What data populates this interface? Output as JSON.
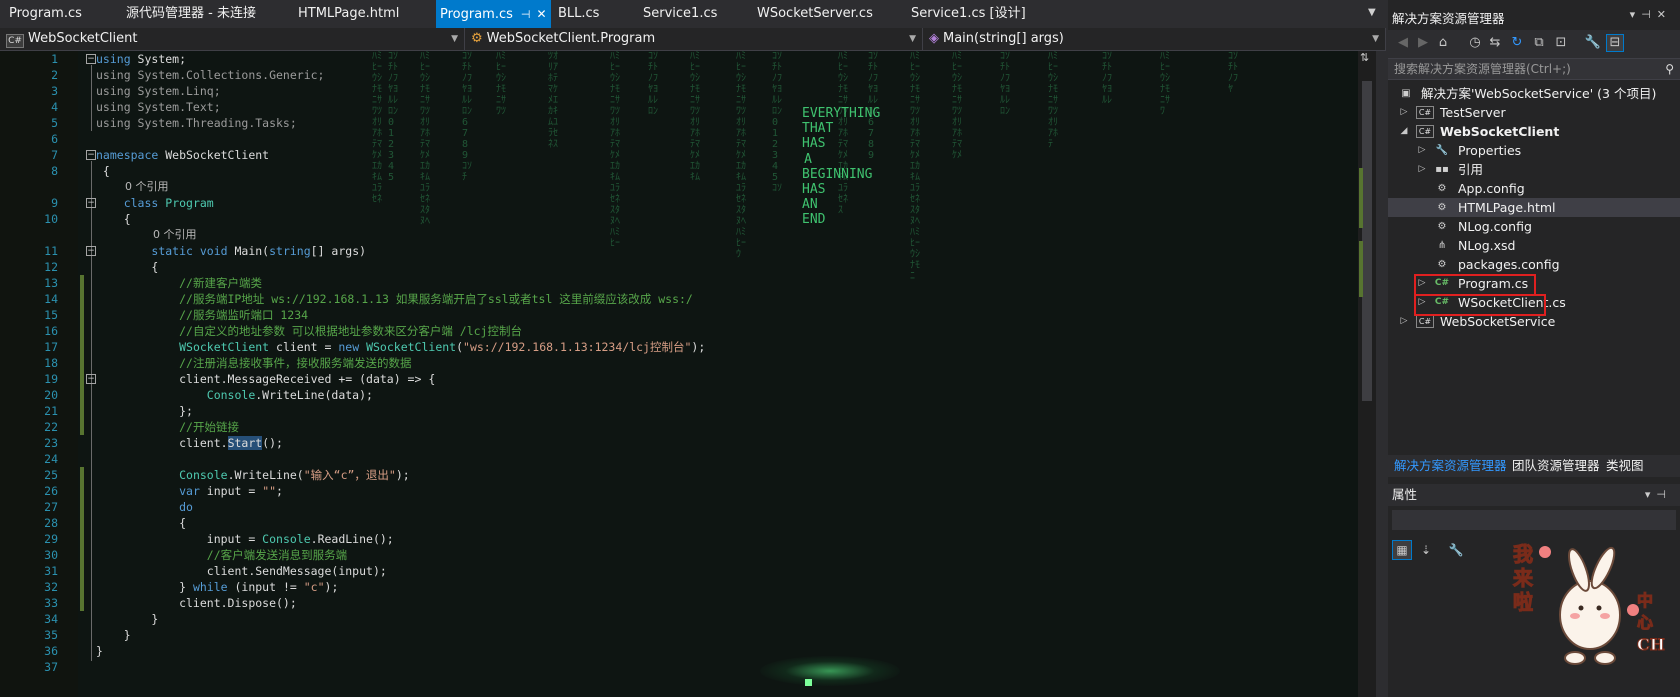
{
  "tabs": [
    {
      "label": "Program.cs"
    },
    {
      "label": "源代码管理器 - 未连接"
    },
    {
      "label": "HTMLPage.html"
    },
    {
      "label": "Program.cs",
      "active": true
    },
    {
      "label": "BLL.cs"
    },
    {
      "label": "Service1.cs"
    },
    {
      "label": "WSocketServer.cs"
    },
    {
      "label": "Service1.cs [设计]"
    }
  ],
  "nav": {
    "project": "WebSocketClient",
    "class": "WebSocketClient.Program",
    "member": "Main(string[] args)"
  },
  "code": {
    "line_numbers": [
      "1",
      "2",
      "3",
      "4",
      "5",
      "6",
      "7",
      "8",
      "9",
      "10",
      "11",
      "12",
      "13",
      "14",
      "15",
      "16",
      "17",
      "18",
      "19",
      "20",
      "21",
      "22",
      "23",
      "24",
      "25",
      "26",
      "27",
      "28",
      "29",
      "30",
      "31",
      "32",
      "33",
      "34",
      "35",
      "36",
      "37"
    ],
    "ref_class": "0 个引用",
    "ref_main": "0 个引用",
    "comments": {
      "new_client": "//新建客户端类",
      "server_ip": "//服务端IP地址 ws://192.168.1.13 如果服务端开启了ssl或者tsl 这里前缀应该改成 wss:/",
      "server_port": "//服务端监听端口 1234",
      "custom_addr": "//自定义的地址参数 可以根据地址参数来区分客户端 /lcj控制台",
      "register": "//注册消息接收事件，接收服务端发送的数据",
      "start_link": "//开始链接",
      "send_msg": "//客户端发送消息到服务端"
    },
    "strings": {
      "ws_url": "\"ws://192.168.1.13:1234/lcj控制台\"",
      "prompt": "\"输入“c”，退出\"",
      "empty": "\"\"",
      "c": "\"c\""
    }
  },
  "background_message": "EVERYTHING THAT HAS A BEGINNING HAS AN END",
  "solution_explorer": {
    "title": "解决方案资源管理器",
    "search_placeholder": "搜索解决方案资源管理器(Ctrl+;)",
    "items": [
      {
        "label": "解决方案'WebSocketService' (3 个项目)"
      },
      {
        "label": "TestServer"
      },
      {
        "label": "WebSocketClient"
      },
      {
        "label": "Properties"
      },
      {
        "label": "引用"
      },
      {
        "label": "App.config"
      },
      {
        "label": "HTMLPage.html"
      },
      {
        "label": "NLog.config"
      },
      {
        "label": "NLog.xsd"
      },
      {
        "label": "packages.config"
      },
      {
        "label": "Program.cs"
      },
      {
        "label": "WSocketClient.cs"
      },
      {
        "label": "WebSocketService"
      }
    ]
  },
  "bottom_tabs": [
    {
      "label": "解决方案资源管理器"
    },
    {
      "label": "团队资源管理器"
    },
    {
      "label": "类视图"
    }
  ],
  "properties": {
    "title": "属性"
  },
  "sticker": {
    "line1": "我来啦",
    "line2": "中心CH"
  },
  "colors": {
    "accent": "#007acc",
    "highlight_box": "#e02020",
    "matrix_green": "#3fc26f"
  }
}
